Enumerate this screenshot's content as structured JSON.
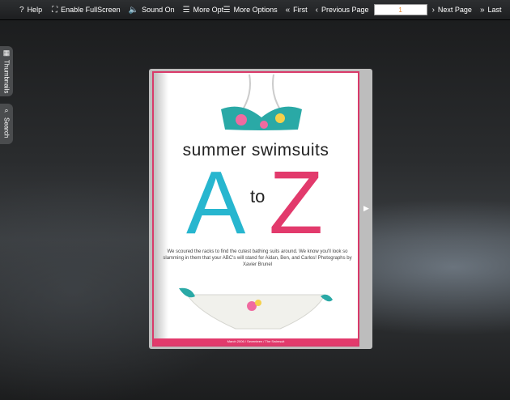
{
  "toolbar": {
    "help_label": "Help",
    "fullscreen_label": "Enable FullScreen",
    "sound_label": "Sound On",
    "more_options_label": "More Options",
    "more_options_label_2": "More Options",
    "first_label": "First",
    "prev_label": "Previous Page",
    "page_value": "1",
    "next_label": "Next Page",
    "last_label": "Last"
  },
  "side_tabs": {
    "thumbnails_label": "Thumbnails",
    "search_label": "Search"
  },
  "page": {
    "headline": "summer swimsuits",
    "letter_a": "A",
    "letter_to": "to",
    "letter_z": "Z",
    "intro": "We scoured the racks to find the cutest bathing suits around. We know you'll look so slamming in them that your ABC's will stand for Aidan, Ben, and Carlos! Photographs by Xavier Brunel",
    "footer_note": "March 2006 / Seventeen / The Swimsuit"
  },
  "colors": {
    "accent_pink": "#e23a6c",
    "accent_teal": "#27b6cf",
    "page_input_text": "#e0832a"
  }
}
